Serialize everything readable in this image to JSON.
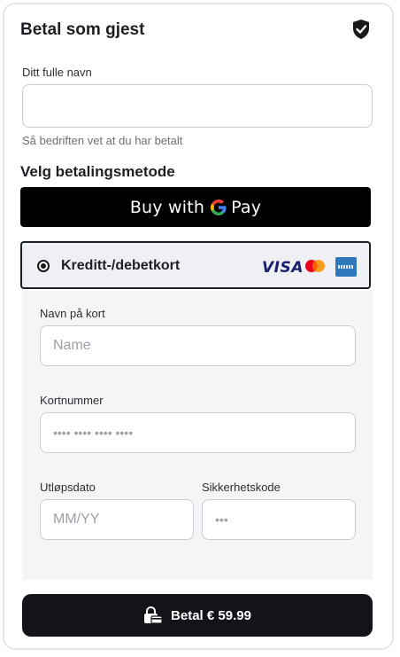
{
  "header": {
    "title": "Betal som gjest",
    "shield_icon": "shield-check-icon"
  },
  "guest": {
    "name_label": "Ditt fulle navn",
    "name_value": "",
    "name_hint": "Så bedriften vet at du har betalt"
  },
  "payment": {
    "section_title": "Velg betalingsmetode",
    "gpay_prefix": "Buy with",
    "gpay_suffix": "Pay",
    "method_label": "Kreditt-/debetkort",
    "card_brands": [
      "VISA",
      "mastercard-icon",
      "amex-icon"
    ]
  },
  "card_form": {
    "name_label": "Navn på kort",
    "name_placeholder": "Name",
    "number_label": "Kortnummer",
    "number_placeholder": "•••• •••• •••• ••••",
    "expiry_label": "Utløpsdato",
    "expiry_placeholder": "MM/YY",
    "cvc_label": "Sikkerhetskode",
    "cvc_placeholder": "•••"
  },
  "submit": {
    "label": "Betal € 59.99",
    "icon": "lock-card-icon"
  },
  "colors": {
    "primary": "#121419",
    "gpay_bg": "#000000",
    "method_bg": "#eef0f3",
    "panel_bg": "#f4f5f7"
  }
}
